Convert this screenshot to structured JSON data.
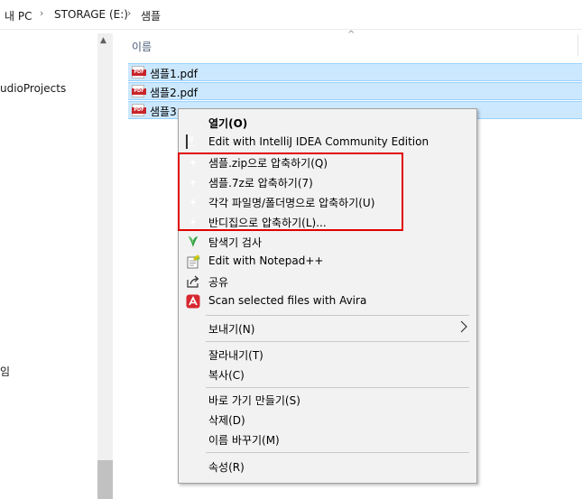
{
  "address_bar": {
    "crumbs": [
      "내 PC",
      "STORAGE (E:)",
      "샘플"
    ],
    "separator": "›"
  },
  "sidebar": {
    "items": [
      "udioProjects",
      "임"
    ]
  },
  "column_header": {
    "name": "이름",
    "sort_indicator": "^"
  },
  "files": [
    {
      "name": "샘플1.pdf",
      "icon": "pdf-icon",
      "selected": true
    },
    {
      "name": "샘플2.pdf",
      "icon": "pdf-icon",
      "selected": true
    },
    {
      "name": "샘플3",
      "icon": "pdf-icon",
      "selected": true
    }
  ],
  "pdf_icon_text": "PDF",
  "context_menu": {
    "items": [
      {
        "label": "열기(O)",
        "icon": "",
        "bold": true
      },
      {
        "label": "Edit with IntelliJ IDEA Community Edition",
        "icon": "intellij-icon",
        "icon_text": "IJ"
      },
      {
        "label": "샘플.zip으로 압축하기(Q)",
        "icon": "bandizip-icon"
      },
      {
        "label": "샘플.7z로 압축하기(7)",
        "icon": "bandizip-icon"
      },
      {
        "label": "각각 파일명/폴더명으로 압축하기(U)",
        "icon": "bandizip-icon"
      },
      {
        "label": "반디집으로 압축하기(L)...",
        "icon": "bandizip-icon"
      },
      {
        "label": "탐색기 검사",
        "icon": "defender-icon"
      },
      {
        "label": "Edit with Notepad++",
        "icon": "notepad-plus-plus-icon"
      },
      {
        "label": "공유",
        "icon": "share-icon"
      },
      {
        "label": "Scan selected files with Avira",
        "icon": "avira-icon"
      },
      {
        "label": "보내기(N)",
        "icon": "",
        "submenu": true
      },
      {
        "label": "잘라내기(T)",
        "icon": ""
      },
      {
        "label": "복사(C)",
        "icon": ""
      },
      {
        "label": "바로 가기 만들기(S)",
        "icon": ""
      },
      {
        "label": "삭제(D)",
        "icon": ""
      },
      {
        "label": "이름 바꾸기(M)",
        "icon": ""
      },
      {
        "label": "속성(R)",
        "icon": ""
      }
    ]
  },
  "colors": {
    "selection_fill": "#cce8ff",
    "selection_border": "#99d1ff",
    "menu_bg": "#f2f2f2",
    "highlight_box": "#e00000",
    "bandizip_blue": "#1f6fe0",
    "pdf_red": "#c8242a"
  }
}
